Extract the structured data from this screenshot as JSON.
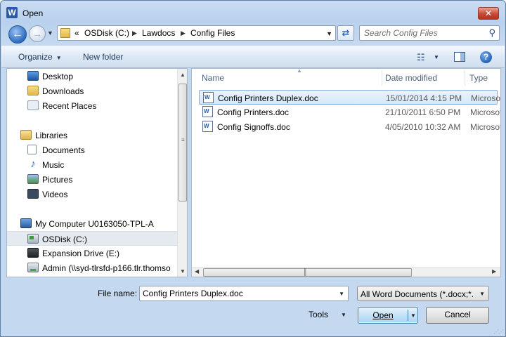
{
  "window": {
    "title": "Open",
    "app_icon": "W",
    "close": "✕"
  },
  "nav": {
    "back": "back-arrow-icon",
    "forward": "forward-arrow-icon",
    "address": {
      "overflow": "«",
      "crumbs": [
        "OSDisk (C:)",
        "Lawdocs",
        "Config Files"
      ]
    },
    "search_placeholder": "Search Config Files"
  },
  "toolbar": {
    "organize": "Organize",
    "new_folder": "New folder"
  },
  "sidebar": {
    "items": [
      {
        "label": "Desktop",
        "icon": "desktop-icon"
      },
      {
        "label": "Downloads",
        "icon": "downloads-icon"
      },
      {
        "label": "Recent Places",
        "icon": "recent-places-icon"
      },
      {
        "label": "Libraries",
        "icon": "libraries-icon"
      },
      {
        "label": "Documents",
        "icon": "documents-icon"
      },
      {
        "label": "Music",
        "icon": "music-icon"
      },
      {
        "label": "Pictures",
        "icon": "pictures-icon"
      },
      {
        "label": "Videos",
        "icon": "videos-icon"
      },
      {
        "label": "My Computer U0163050-TPL-A",
        "icon": "computer-icon"
      },
      {
        "label": "OSDisk (C:)",
        "icon": "drive-icon",
        "selected": true
      },
      {
        "label": "Expansion Drive (E:)",
        "icon": "external-drive-icon"
      },
      {
        "label": "Admin (\\\\syd-tlrsfd-p166.tlr.thomso",
        "icon": "network-drive-icon"
      }
    ]
  },
  "files": {
    "columns": [
      "Name",
      "Date modified",
      "Type"
    ],
    "rows": [
      {
        "name": "Config Printers Duplex.doc",
        "date": "15/01/2014 4:15 PM",
        "type": "Microsoft",
        "selected": true
      },
      {
        "name": "Config Printers.doc",
        "date": "21/10/2011 6:50 PM",
        "type": "Microsoft"
      },
      {
        "name": "Config Signoffs.doc",
        "date": "4/05/2010 10:32 AM",
        "type": "Microsoft"
      }
    ]
  },
  "footer": {
    "file_name_label": "File name:",
    "file_name_value": "Config Printers Duplex.doc",
    "file_type": "All Word Documents (*.docx;*.d",
    "tools": "Tools",
    "open": "Open",
    "cancel": "Cancel"
  }
}
